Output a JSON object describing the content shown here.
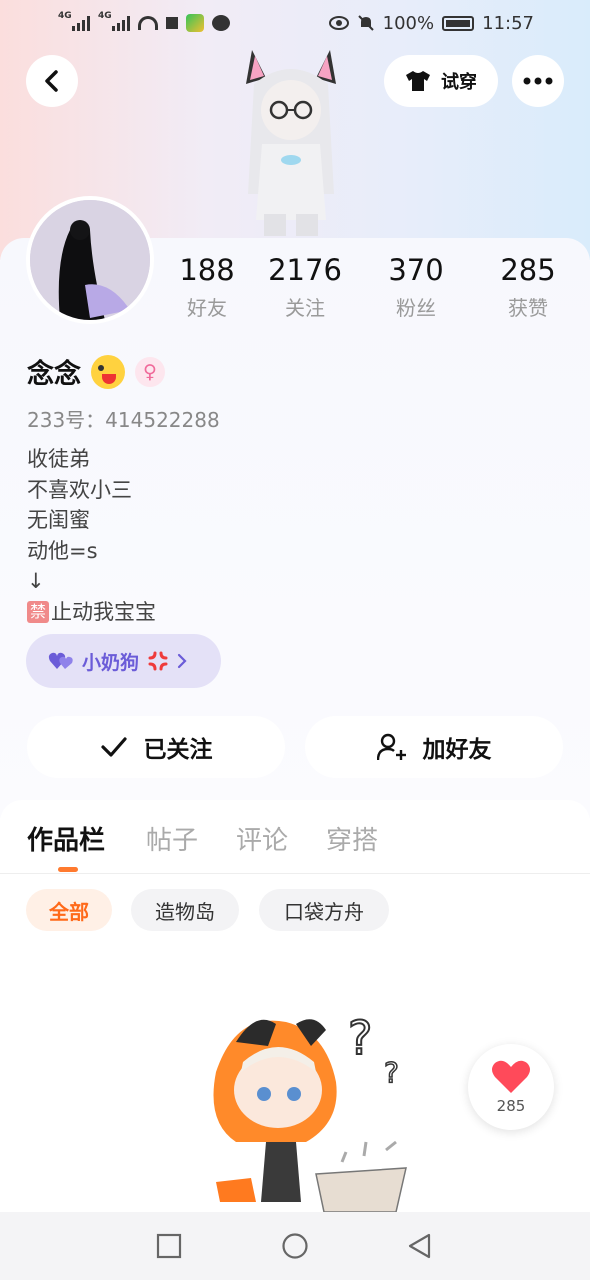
{
  "status_bar": {
    "network_1": "4G",
    "network_2": "4G",
    "battery": "100%",
    "time": "11:57"
  },
  "header": {
    "try_on_label": "试穿"
  },
  "stats": [
    {
      "value": "188",
      "label": "好友"
    },
    {
      "value": "2176",
      "label": "关注"
    },
    {
      "value": "370",
      "label": "粉丝"
    },
    {
      "value": "285",
      "label": "获赞"
    }
  ],
  "profile": {
    "nickname": "念念",
    "gender_symbol": "♀",
    "uid": "233号：414522288",
    "bio": [
      "收徒弟",
      "不喜欢小三",
      "无闺蜜",
      "动他=s",
      "↓"
    ],
    "bio_ban_char": "禁",
    "bio_last": "止动我宝宝",
    "tag": "小奶狗"
  },
  "actions": {
    "follow_label": "已关注",
    "add_friend_label": "加好友"
  },
  "tabs": [
    "作品栏",
    "帖子",
    "评论",
    "穿搭"
  ],
  "filters": [
    "全部",
    "造物岛",
    "口袋方舟"
  ],
  "like_float": {
    "count": "285"
  },
  "colors": {
    "accent": "#ff7a2f",
    "tag_purple": "#6b5cd8",
    "heart_red": "#ff4a5a"
  }
}
